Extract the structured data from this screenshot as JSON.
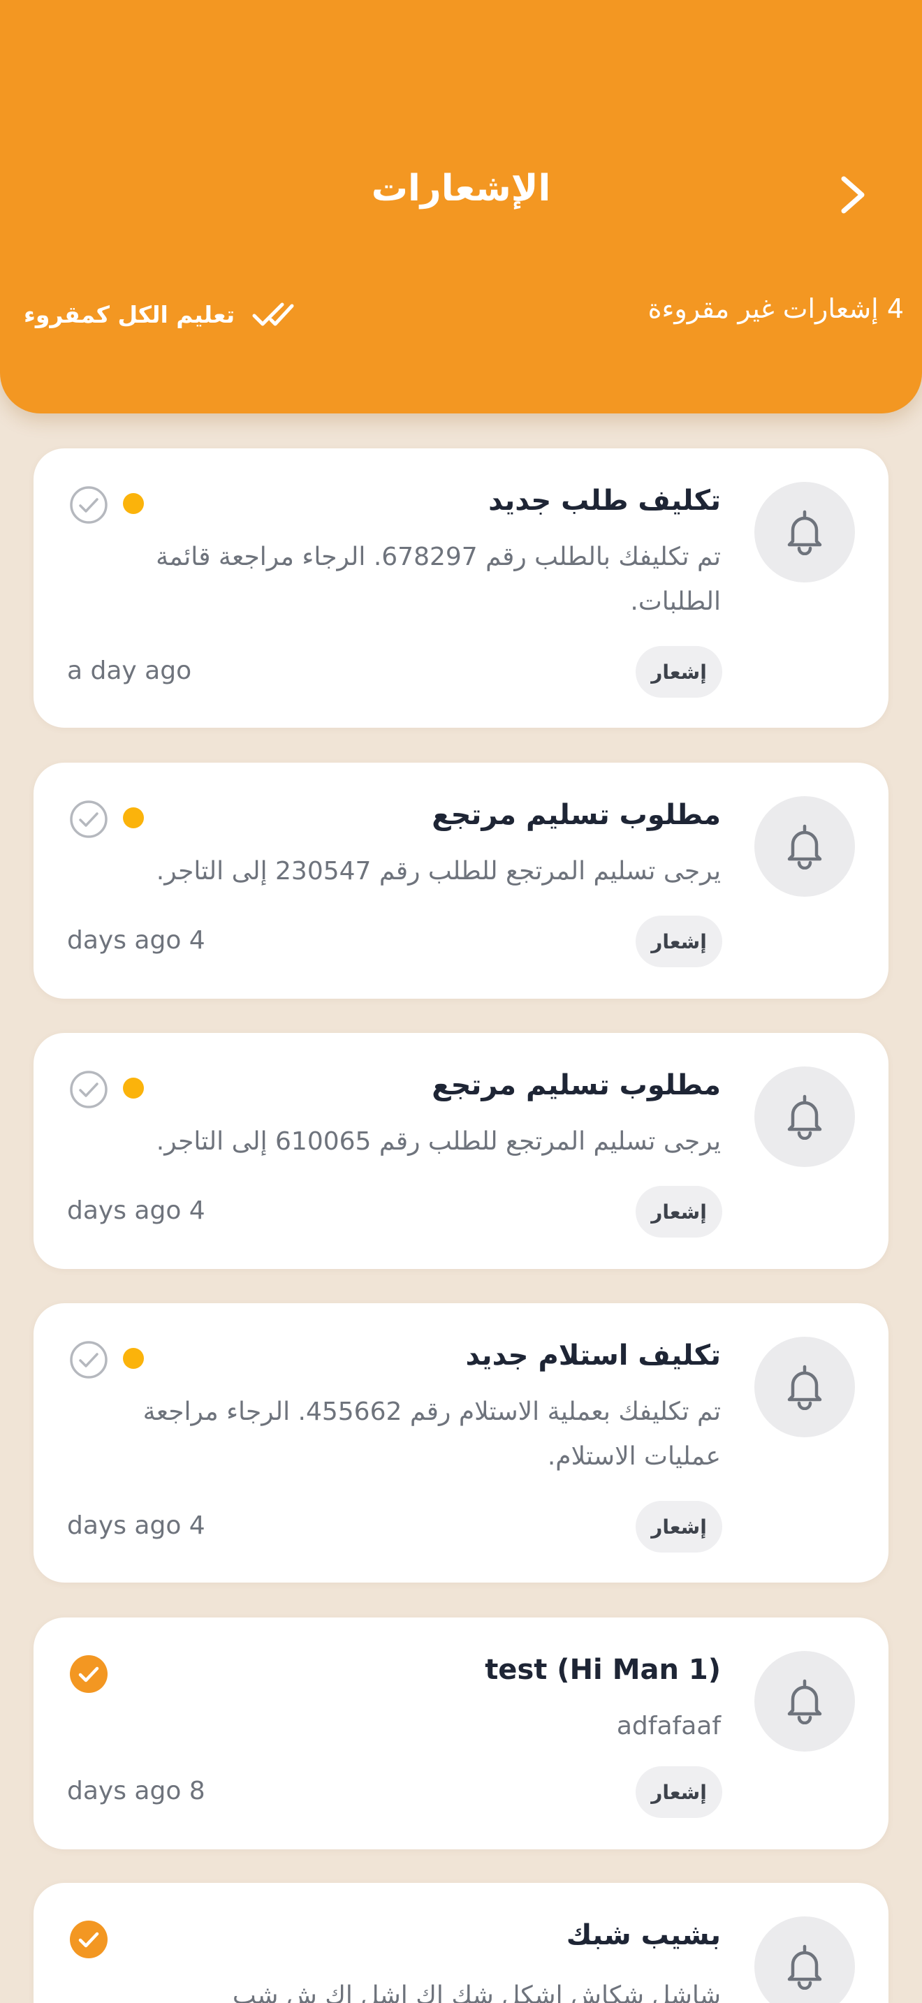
{
  "header": {
    "title": "الإشعارات",
    "unread_label": "4 إشعارات غير مقروءة",
    "mark_all_label": "تعليم الكل كمقروء"
  },
  "notifications": [
    {
      "title": "تكليف طلب جديد",
      "body": "تم تكليفك بالطلب رقم 678297. الرجاء مراجعة قائمة الطلبات.",
      "time": "a day ago",
      "badge": "إشعار",
      "read": false,
      "icon": "bell-icon"
    },
    {
      "title": "مطلوب تسليم مرتجع",
      "body": "يرجى تسليم المرتجع للطلب رقم 230547 إلى التاجر.",
      "time": "days ago 4",
      "badge": "إشعار",
      "read": false,
      "icon": "bell-icon"
    },
    {
      "title": "مطلوب تسليم مرتجع",
      "body": "يرجى تسليم المرتجع للطلب رقم 610065 إلى التاجر.",
      "time": "days ago 4",
      "badge": "إشعار",
      "read": false,
      "icon": "bell-icon"
    },
    {
      "title": "تكليف استلام جديد",
      "body": "تم تكليفك بعملية الاستلام رقم 455662. الرجاء مراجعة عمليات الاستلام.",
      "time": "days ago 4",
      "badge": "إشعار",
      "read": false,
      "icon": "bell-icon"
    },
    {
      "title": "test (Hi Man 1)",
      "body": "adfafaaf",
      "time": "days ago 8",
      "badge": "إشعار",
      "read": true,
      "icon": "bell-icon"
    },
    {
      "title": "بشيب شبك",
      "body": "شاشل شكاش اشكل شك اك اشل اك ش شب",
      "read": true,
      "icon": "bell-icon"
    }
  ],
  "colors": {
    "header": "#F39722",
    "background": "#F0E4D6",
    "unread_dot": "#FBB30B",
    "read_check": "#F39722"
  }
}
